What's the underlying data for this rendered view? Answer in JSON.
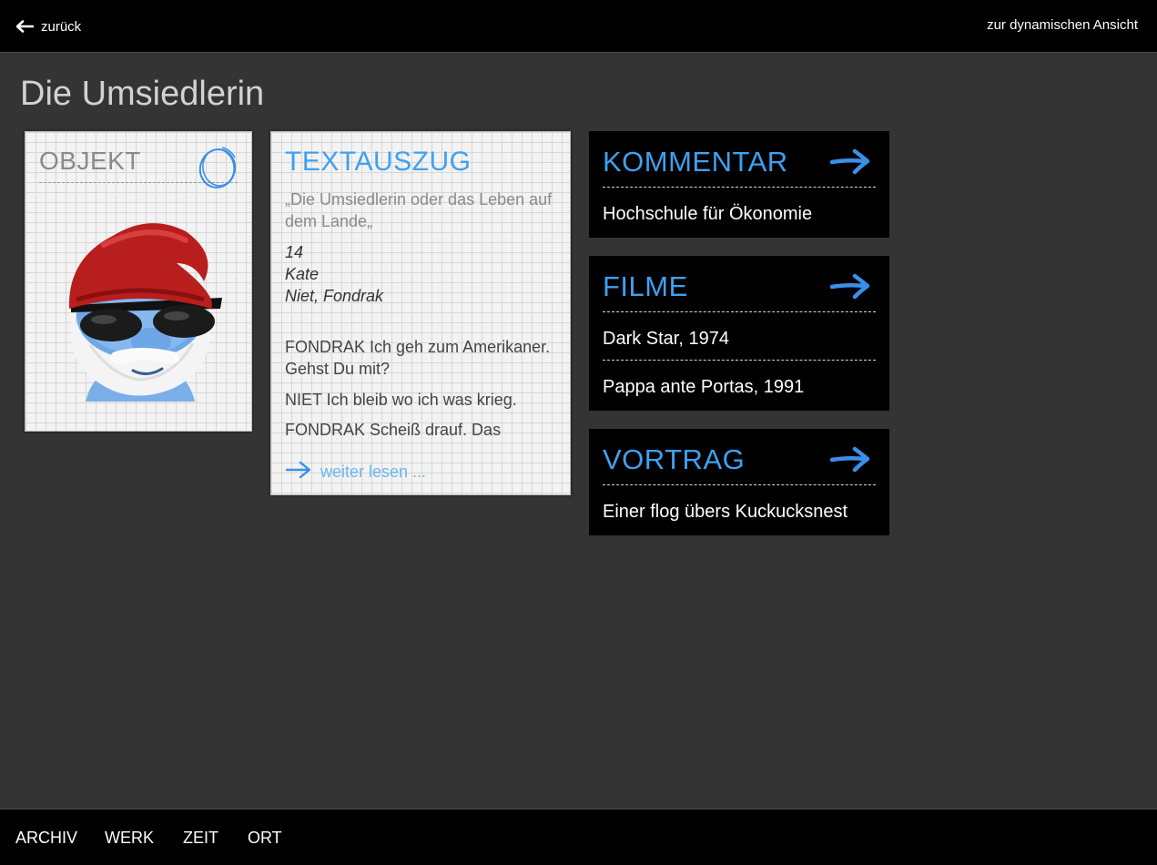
{
  "header": {
    "back_label": "zurück",
    "dynamic_view_label": "zur dynamischen Ansicht"
  },
  "page": {
    "title": "Die Umsiedlerin"
  },
  "objekt_card": {
    "title": "OBJEKT",
    "image_icon": "smurf-with-sunglasses-image"
  },
  "textauszug_card": {
    "title": "TEXTAUSZUG",
    "quote": "„Die Umsiedlerin oder das Leben auf dem Lande„",
    "meta": [
      "14",
      "Kate",
      "Niet, Fondrak"
    ],
    "dialog": [
      "FONDRAK Ich geh zum Amerikaner. Gehst Du mit?",
      "NIET Ich bleib wo ich was krieg.",
      "FONDRAK Scheiß drauf. Das"
    ],
    "read_more": "weiter lesen ..."
  },
  "kommentar_card": {
    "title": "KOMMENTAR",
    "items": [
      "Hochschule für Ökonomie"
    ]
  },
  "filme_card": {
    "title": "FILME",
    "items": [
      "Dark Star, 1974",
      "Pappa ante Portas, 1991"
    ]
  },
  "vortrag_card": {
    "title": "VORTRAG",
    "items": [
      "Einer flog übers Kuckucksnest"
    ]
  },
  "bottom_nav": {
    "items": [
      "ARCHIV",
      "WERK",
      "ZEIT",
      "ORT"
    ]
  },
  "colors": {
    "accent": "#3fa0f0",
    "background": "#343434",
    "bar": "#000000"
  }
}
